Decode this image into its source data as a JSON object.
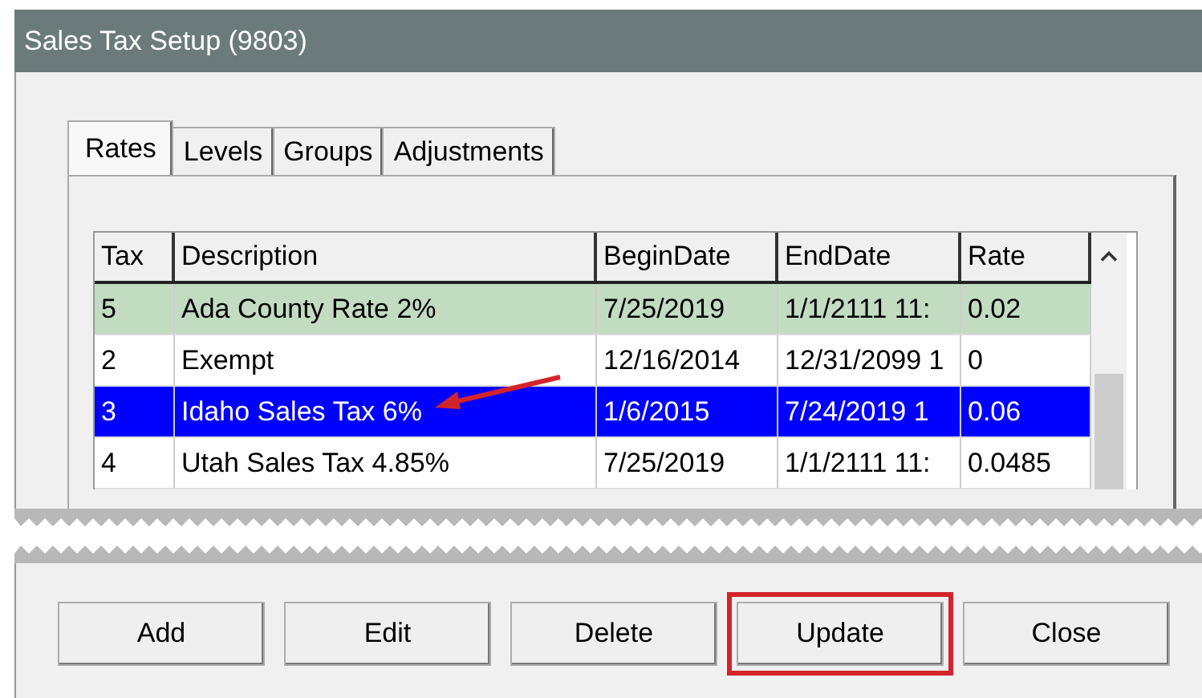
{
  "window": {
    "title": "Sales Tax Setup (9803)"
  },
  "tabs": [
    {
      "label": "Rates",
      "selected": true
    },
    {
      "label": "Levels",
      "selected": false
    },
    {
      "label": "Groups",
      "selected": false
    },
    {
      "label": "Adjustments",
      "selected": false
    }
  ],
  "table": {
    "columns": [
      "Tax",
      "Description",
      "BeginDate",
      "EndDate",
      "Rate"
    ],
    "rows": [
      {
        "cells": [
          "5",
          "Ada County Rate 2%",
          "7/25/2019",
          "1/1/2111 11:",
          "0.02"
        ],
        "highlighted": true,
        "selected": false,
        "arrow": false
      },
      {
        "cells": [
          "2",
          "Exempt",
          "12/16/2014",
          "12/31/2099 1",
          "0"
        ],
        "highlighted": false,
        "selected": false,
        "arrow": false
      },
      {
        "cells": [
          "3",
          "Idaho Sales Tax 6%",
          "1/6/2015",
          "7/24/2019 1",
          "0.06"
        ],
        "highlighted": false,
        "selected": true,
        "arrow": true
      },
      {
        "cells": [
          "4",
          "Utah Sales Tax 4.85%",
          "7/25/2019",
          "1/1/2111 11:",
          "0.0485"
        ],
        "highlighted": false,
        "selected": false,
        "arrow": false
      }
    ]
  },
  "buttons": [
    {
      "label": "Add",
      "highlighted": false
    },
    {
      "label": "Edit",
      "highlighted": false
    },
    {
      "label": "Delete",
      "highlighted": false
    },
    {
      "label": "Update",
      "highlighted": true
    },
    {
      "label": "Close",
      "highlighted": false
    }
  ]
}
